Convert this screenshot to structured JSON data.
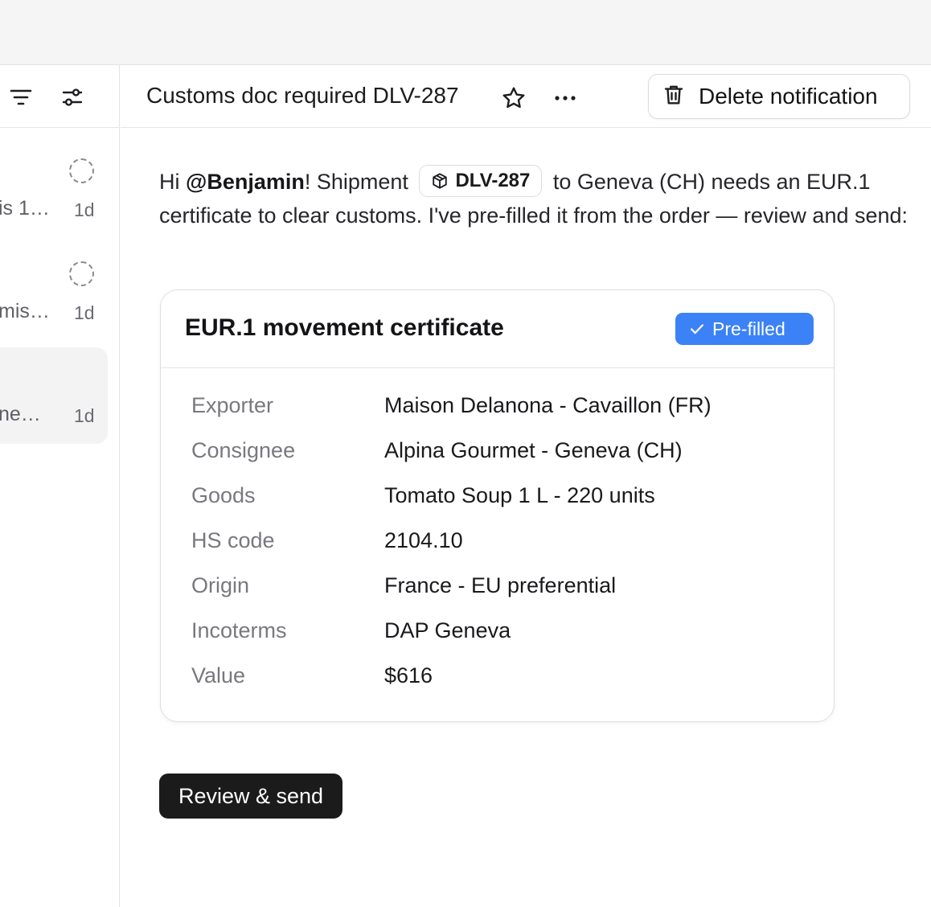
{
  "sidebar": {
    "items": [
      {
        "snippet": "is 1…",
        "age": "1d"
      },
      {
        "snippet": "mis…",
        "age": "1d"
      },
      {
        "snippet": "ne…",
        "age": "1d"
      }
    ]
  },
  "header": {
    "title": "Customs doc required DLV-287",
    "delete_label": "Delete notification"
  },
  "message": {
    "greeting": "Hi ",
    "mention": "@Benjamin",
    "after_mention": "! Shipment ",
    "chip_label": "DLV-287",
    "body": " to Geneva (CH) needs an EUR.1 certificate to clear customs. I've pre-filled it from the order — review and send:"
  },
  "card": {
    "title": "EUR.1 movement certificate",
    "badge": "Pre-filled",
    "badge_color": "#3b82f6",
    "fields": [
      {
        "label": "Exporter",
        "value": "Maison Delanona - Cavaillon (FR)"
      },
      {
        "label": "Consignee",
        "value": "Alpina Gourmet - Geneva (CH)"
      },
      {
        "label": "Goods",
        "value": "Tomato Soup 1 L - 220 units"
      },
      {
        "label": "HS code",
        "value": "2104.10"
      },
      {
        "label": "Origin",
        "value": "France - EU preferential"
      },
      {
        "label": "Incoterms",
        "value": "DAP Geneva"
      },
      {
        "label": "Value",
        "value": "$616"
      }
    ]
  },
  "actions": {
    "review_label": "Review & send"
  }
}
